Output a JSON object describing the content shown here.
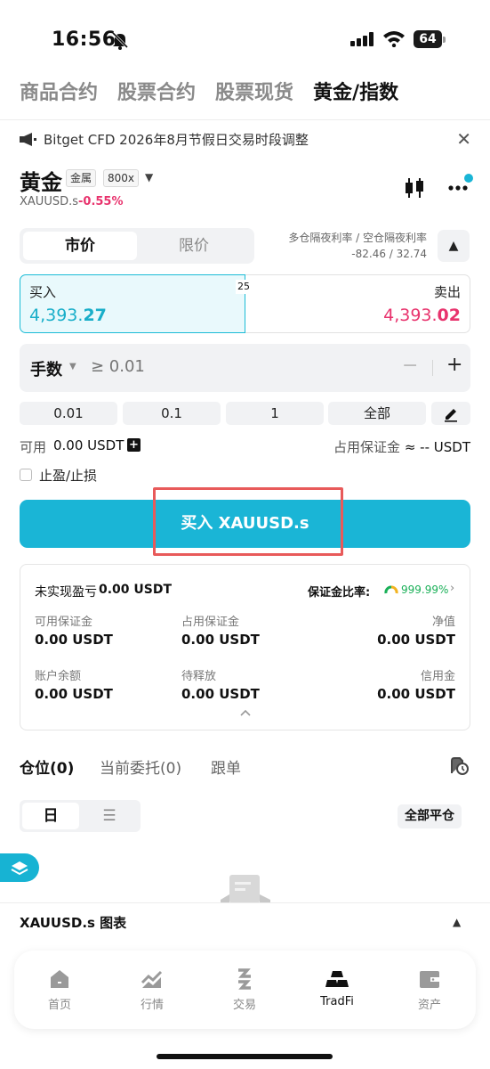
{
  "status": {
    "time": "16:56",
    "battery": "64"
  },
  "top_tabs": [
    "商品合约",
    "股票合约",
    "股票现货",
    "黄金/指数"
  ],
  "notice": {
    "text": "Bitget CFD 2026年8月节假日交易时段调整"
  },
  "symbol": {
    "name": "黄金",
    "tag_category": "金属",
    "tag_leverage": "800x",
    "code": "XAUUSD.s",
    "change": "-0.55%"
  },
  "order_type": {
    "market": "市价",
    "limit": "限价"
  },
  "overnight": {
    "label": "多仓隔夜利率 / 空仓隔夜利率",
    "value": "-82.46 / 32.74"
  },
  "quote": {
    "buy_label": "买入",
    "buy_price_main": "4,393.",
    "buy_price_tail": "27",
    "sell_label": "卖出",
    "sell_price_main": "4,393.",
    "sell_price_tail": "02",
    "spread": "25"
  },
  "lots": {
    "label": "手数",
    "placeholder": "≥ 0.01",
    "minus": "−",
    "plus": "+"
  },
  "quick_amounts": [
    "0.01",
    "0.1",
    "1",
    "全部"
  ],
  "available": {
    "label": "可用",
    "value": "0.00 USDT",
    "margin_label": "占用保证金",
    "margin_value": "≈ -- USDT"
  },
  "tpsl": {
    "label": "止盈/止损"
  },
  "action": {
    "buy_button": "买入 XAUUSD.s"
  },
  "account": {
    "unrealized_label": "未实现盈亏",
    "unrealized_value": "0.00 USDT",
    "ratio_label": "保证金比率:",
    "ratio_value": "999.99%",
    "fields": [
      {
        "label": "可用保证金",
        "value": "0.00 USDT"
      },
      {
        "label": "占用保证金",
        "value": "0.00 USDT"
      },
      {
        "label": "净值",
        "value": "0.00 USDT"
      },
      {
        "label": "账户余额",
        "value": "0.00 USDT"
      },
      {
        "label": "待释放",
        "value": "0.00 USDT"
      },
      {
        "label": "信用金",
        "value": "0.00 USDT"
      }
    ]
  },
  "positions": {
    "tabs": [
      "仓位(0)",
      "当前委托(0)",
      "跟单"
    ],
    "view_day": "日",
    "view_list": "☰",
    "close_all": "全部平仓"
  },
  "chart_bar": {
    "title": "XAUUSD.s  图表"
  },
  "bottom_nav": [
    {
      "label": "首页",
      "icon": "home-icon"
    },
    {
      "label": "行情",
      "icon": "market-icon"
    },
    {
      "label": "交易",
      "icon": "trade-icon"
    },
    {
      "label": "TradFi",
      "icon": "tradfi-icon"
    },
    {
      "label": "资产",
      "icon": "wallet-icon"
    }
  ],
  "colors": {
    "accent": "#1ab5d6",
    "down": "#e8336d",
    "up": "#1ab058",
    "highlight": "#e85a5a"
  }
}
